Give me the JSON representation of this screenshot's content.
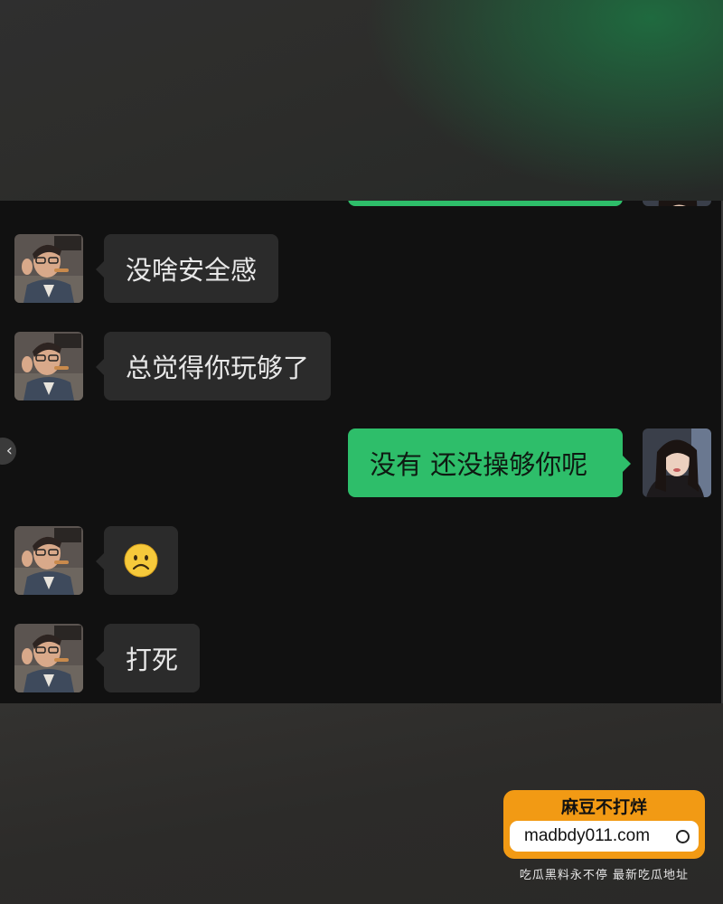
{
  "messages": [
    {
      "side": "in",
      "text": "没啥安全感"
    },
    {
      "side": "in",
      "text": "总觉得你玩够了"
    },
    {
      "side": "out",
      "text": "没有 还没操够你呢"
    },
    {
      "side": "in",
      "emoji": "frowning-face"
    },
    {
      "side": "in",
      "text": "打死"
    }
  ],
  "nav": {
    "back_arrow": "‹"
  },
  "watermark": {
    "title": "麻豆不打烊",
    "url": "madbdy011.com",
    "subtitle": "吃瓜黑料永不停 最新吃瓜地址"
  },
  "colors": {
    "incoming_bubble": "#2b2b2b",
    "outgoing_bubble": "#2ebe6a",
    "chat_background": "#111111",
    "watermark_orange": "#f29a14"
  }
}
